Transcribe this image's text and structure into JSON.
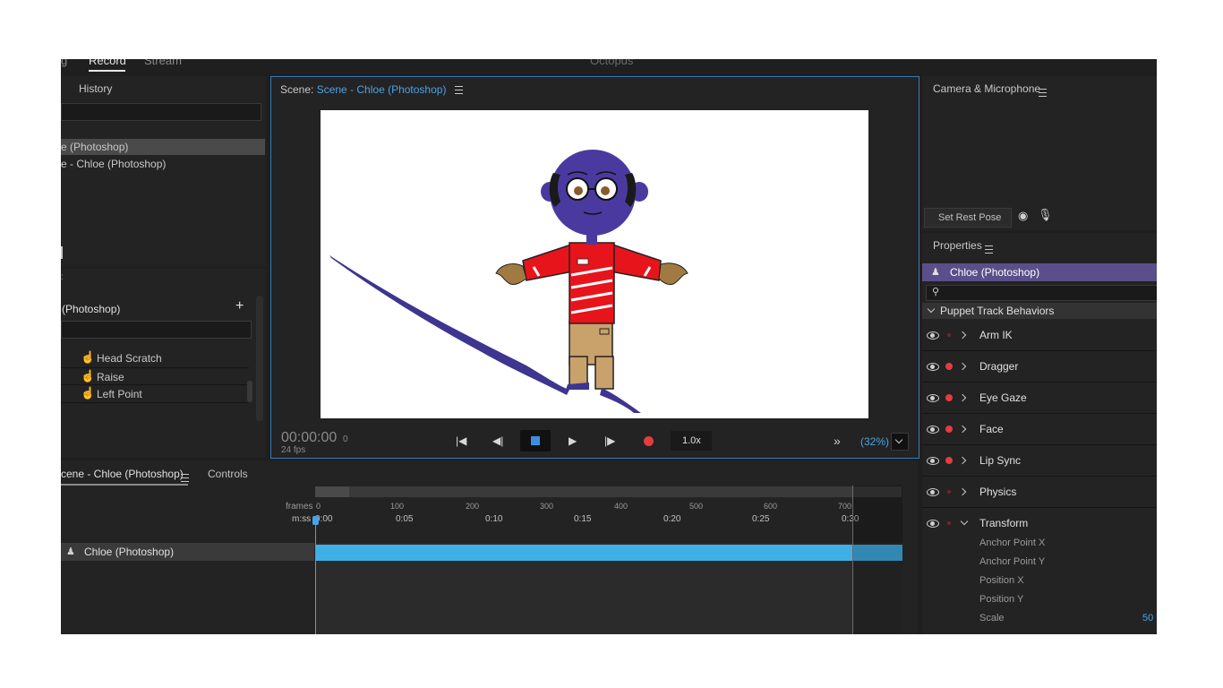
{
  "top_tabs": {
    "partial_left": "g",
    "record": "Record",
    "stream": "Stream",
    "app_title": "Octopus"
  },
  "history": {
    "title": "History",
    "items": [
      "e (Photoshop)",
      "e - Chloe (Photoshop)"
    ]
  },
  "behaviors_list": {
    "title": "(Photoshop)",
    "add_label": "+",
    "items": [
      "Head Scratch",
      "Raise",
      "Left Point"
    ]
  },
  "scene_panel": {
    "prefix": "Scene:",
    "name": "Scene - Chloe (Photoshop)",
    "timecode": "00:00:00",
    "frame_index": "0",
    "fps": "24 fps",
    "speed": "1.0x",
    "zoom": "(32%)",
    "more": "»"
  },
  "timeline": {
    "tab_active": "cene - Chloe (Photoshop)",
    "tab_controls": "Controls",
    "frames_label": "frames",
    "time_label": "m:ss",
    "frame_ticks": [
      "0",
      "100",
      "200",
      "300",
      "400",
      "500",
      "600",
      "700"
    ],
    "time_ticks": [
      "0:00",
      "0:05",
      "0:10",
      "0:15",
      "0:20",
      "0:25",
      "0:30"
    ],
    "track_name": "Chloe (Photoshop)"
  },
  "camera": {
    "title": "Camera & Microphone",
    "set_rest_pose": "Set Rest Pose"
  },
  "properties": {
    "title": "Properties",
    "puppet_name": "Chloe (Photoshop)",
    "section": "Puppet Track Behaviors",
    "behaviors": [
      {
        "label": "Arm IK",
        "armed": false
      },
      {
        "label": "Dragger",
        "armed": true
      },
      {
        "label": "Eye Gaze",
        "armed": true
      },
      {
        "label": "Face",
        "armed": true
      },
      {
        "label": "Lip Sync",
        "armed": true
      },
      {
        "label": "Physics",
        "armed": false
      },
      {
        "label": "Transform",
        "armed": false
      }
    ],
    "transform_params": [
      "Anchor Point X",
      "Anchor Point Y",
      "Position X",
      "Position Y",
      "Scale"
    ],
    "scale_value": "50"
  },
  "colors": {
    "accent": "#4aa3e6",
    "track_bar": "#3fb0e6",
    "record_red": "#e33d3d",
    "puppet_blue": "#4a3aa0",
    "shirt_red": "#e8141c",
    "pants_tan": "#c9a26b"
  }
}
